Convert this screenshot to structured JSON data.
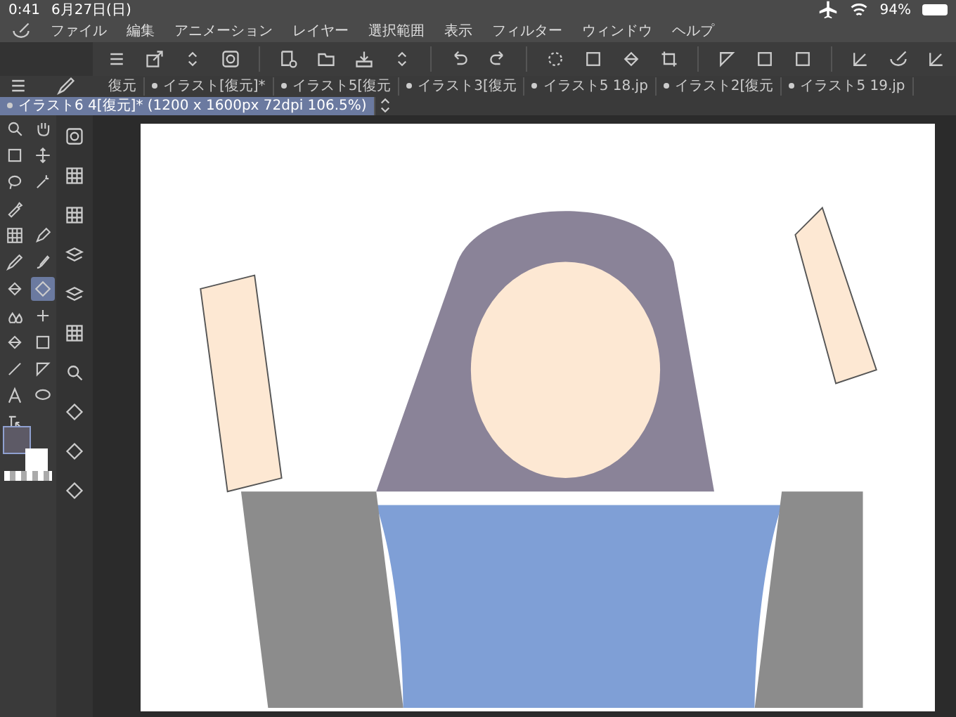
{
  "status_bar": {
    "time": "0:41",
    "date": "6月27日(日)",
    "battery": "94%"
  },
  "menu": [
    "ファイル",
    "編集",
    "アニメーション",
    "レイヤー",
    "選択範囲",
    "表示",
    "フィルター",
    "ウィンドウ",
    "ヘルプ"
  ],
  "tabs": [
    {
      "label": "復元",
      "selected": false
    },
    {
      "label": "イラスト[復元]*",
      "selected": false
    },
    {
      "label": "イラスト5[復元",
      "selected": false
    },
    {
      "label": "イラスト3[復元",
      "selected": false
    },
    {
      "label": "イラスト5 18.jp",
      "selected": false
    },
    {
      "label": "イラスト2[復元",
      "selected": false
    },
    {
      "label": "イラスト5 19.jp",
      "selected": false
    },
    {
      "label": "イラスト6 4[復元]* (1200 x 1600px 72dpi 106.5%)",
      "selected": true
    }
  ]
}
